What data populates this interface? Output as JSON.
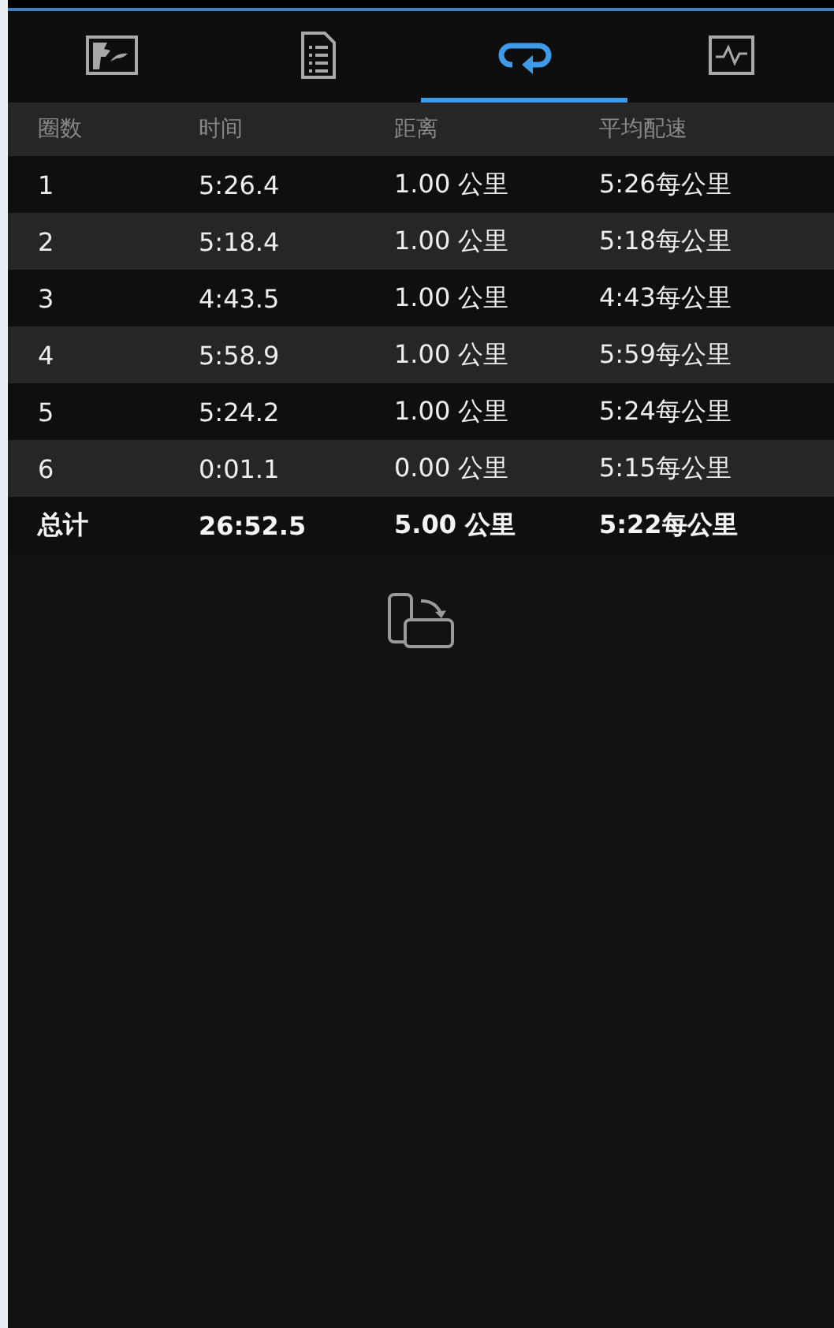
{
  "tabs": [
    {
      "kind": "map",
      "selected": false
    },
    {
      "kind": "list",
      "selected": false
    },
    {
      "kind": "laps",
      "selected": true
    },
    {
      "kind": "chart",
      "selected": false
    }
  ],
  "table": {
    "columns": [
      "圈数",
      "时间",
      "距离",
      "平均配速"
    ],
    "rows": [
      [
        "1",
        "5:26.4",
        "1.00 公里",
        "5:26每公里"
      ],
      [
        "2",
        "5:18.4",
        "1.00 公里",
        "5:18每公里"
      ],
      [
        "3",
        "4:43.5",
        "1.00 公里",
        "4:43每公里"
      ],
      [
        "4",
        "5:58.9",
        "1.00 公里",
        "5:59每公里"
      ],
      [
        "5",
        "5:24.2",
        "1.00 公里",
        "5:24每公里"
      ],
      [
        "6",
        "0:01.1",
        "0.00 公里",
        "5:15每公里"
      ]
    ],
    "total": [
      "总计",
      "26:52.5",
      "5.00 公里",
      "5:22每公里"
    ]
  }
}
